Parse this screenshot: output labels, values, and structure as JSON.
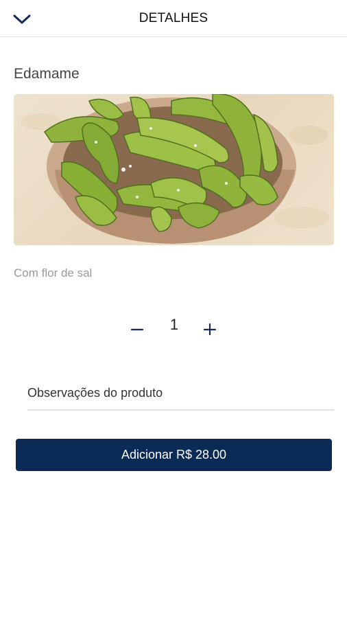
{
  "header": {
    "title": "DETALHES",
    "back_icon": "chevron-down-icon"
  },
  "product": {
    "name": "Edamame",
    "description": "Com flor de sal",
    "image_icon": "edamame-bowl-image"
  },
  "quantity": {
    "value": "1",
    "minus_icon": "minus-icon",
    "plus_icon": "plus-icon"
  },
  "notes": {
    "placeholder": "Observações do produto",
    "value": ""
  },
  "add_button": {
    "label": "Adicionar R$ 28.00"
  },
  "colors": {
    "primary": "#0b2a55",
    "accent_icon": "#13285a"
  }
}
